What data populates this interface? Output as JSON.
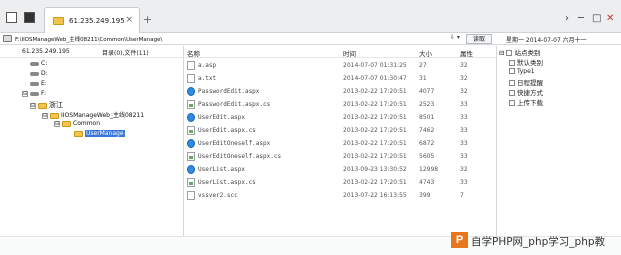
{
  "tab": {
    "title": "61.235.249.195",
    "close": "×",
    "new": "+"
  },
  "window_controls": {
    "nav": "›",
    "minimize": "─",
    "maximize": "□",
    "close": "✕"
  },
  "address": {
    "path": "F:\\IIOSManageWeb_主线08211\\Common\\UserManage\\",
    "dropdown": "⇩ ▾",
    "button": "读取"
  },
  "date": "星期一 2014-07-07 六月十一",
  "left": {
    "ip": "61.235.249.195",
    "summary": "目录(0),文件(11)",
    "tree": [
      {
        "label": "C:",
        "type": "drive"
      },
      {
        "label": "D:",
        "type": "drive"
      },
      {
        "label": "E:",
        "type": "drive"
      },
      {
        "label": "F:",
        "type": "drive",
        "expander": "⊟"
      },
      {
        "label": "浙江",
        "type": "folder",
        "expander": "⊟"
      },
      {
        "label": "IIOSManageWeb_主线08211",
        "type": "folder",
        "expander": "⊟"
      },
      {
        "label": "Common",
        "type": "folder",
        "expander": "⊟"
      },
      {
        "label": "UserManage",
        "type": "folder",
        "selected": true
      }
    ]
  },
  "columns": {
    "name": "名称",
    "time": "时间",
    "size": "大小",
    "attr": "属性"
  },
  "files": [
    {
      "name": "a.asp",
      "time": "2014-07-07 01:31:25",
      "size": "27",
      "attr": "32",
      "icon": "document-icon"
    },
    {
      "name": "a.txt",
      "time": "2014-07-07 01:30:47",
      "size": "31",
      "attr": "32",
      "icon": "document-icon"
    },
    {
      "name": "PasswordEdit.aspx",
      "time": "2013-02-22 17:20:51",
      "size": "4077",
      "attr": "32",
      "icon": "aspx-icon"
    },
    {
      "name": "PasswordEdit.aspx.cs",
      "time": "2013-02-22 17:20:51",
      "size": "2523",
      "attr": "33",
      "icon": "cs-icon"
    },
    {
      "name": "UserEdit.aspx",
      "time": "2013-02-22 17:20:51",
      "size": "8501",
      "attr": "33",
      "icon": "aspx-icon"
    },
    {
      "name": "UserEdit.aspx.cs",
      "time": "2013-02-22 17:20:51",
      "size": "7462",
      "attr": "33",
      "icon": "cs-icon"
    },
    {
      "name": "UserEditOneself.aspx",
      "time": "2013-02-22 17:20:51",
      "size": "6872",
      "attr": "33",
      "icon": "aspx-icon"
    },
    {
      "name": "UserEditOneself.aspx.cs",
      "time": "2013-02-22 17:20:51",
      "size": "5605",
      "attr": "33",
      "icon": "cs-icon"
    },
    {
      "name": "UserList.aspx",
      "time": "2013-09-23 13:30:52",
      "size": "12998",
      "attr": "32",
      "icon": "aspx-icon"
    },
    {
      "name": "UserList.aspx.cs",
      "time": "2013-02-22 17:20:51",
      "size": "4743",
      "attr": "33",
      "icon": "cs-icon"
    },
    {
      "name": "vssver2.scc",
      "time": "2013-07-22 16:13:55",
      "size": "399",
      "attr": "7",
      "icon": "document-icon"
    }
  ],
  "side": {
    "category": "站点类别",
    "default_category": "默认类别",
    "type1": "Type1",
    "schedule": "日程提醒",
    "shortcuts": "快捷方式",
    "uploads": "上传下载",
    "expander": "⊟"
  },
  "watermark": {
    "logo": "P",
    "text": "自学PHP网_php学习_php教"
  },
  "colors": {
    "selection": "#3a78d8",
    "folder": "#f2c44d",
    "aspx_icon": "#2f8be0",
    "watermark_logo": "#e8761c"
  }
}
